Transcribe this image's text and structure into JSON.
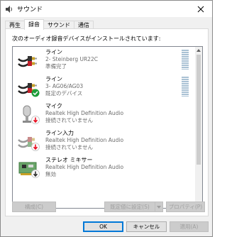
{
  "window": {
    "title": "サウンド"
  },
  "tabs": [
    {
      "label": "再生"
    },
    {
      "label": "録音"
    },
    {
      "label": "サウンド"
    },
    {
      "label": "通信"
    }
  ],
  "panel": {
    "caption": "次のオーディオ録音デバイスがインストールされています:"
  },
  "devices": [
    {
      "name": "ライン",
      "detail": "2- Steinberg UR22C",
      "status": "準備完了",
      "icon": "rca-cable-icon",
      "badge": ""
    },
    {
      "name": "ライン",
      "detail": "3- AG06/AG03",
      "status": "既定のデバイス",
      "icon": "rca-cable-icon",
      "badge": "default-check-badge"
    },
    {
      "name": "マイク",
      "detail": "Realtek High Definition Audio",
      "status": "接続されていません",
      "icon": "microphone-icon",
      "badge": "disconnected-arrow-badge"
    },
    {
      "name": "ライン入力",
      "detail": "Realtek High Definition Audio",
      "status": "接続されていません",
      "icon": "rca-cable-icon",
      "badge": "disconnected-arrow-badge"
    },
    {
      "name": "ステレオ ミキサー",
      "detail": "Realtek High Definition Audio",
      "status": "無効",
      "icon": "circuit-board-icon",
      "badge": "disabled-arrow-badge"
    }
  ],
  "buttons": {
    "configure": "構成(C)",
    "set_default": "既定値に設定(S)",
    "properties": "プロパティ(P)",
    "ok": "OK",
    "cancel": "キャンセル",
    "apply": "適用(A)"
  },
  "colors": {
    "accent": "#0078d7",
    "default_check": "#1e9d3a",
    "disconnected": "#e81123"
  }
}
